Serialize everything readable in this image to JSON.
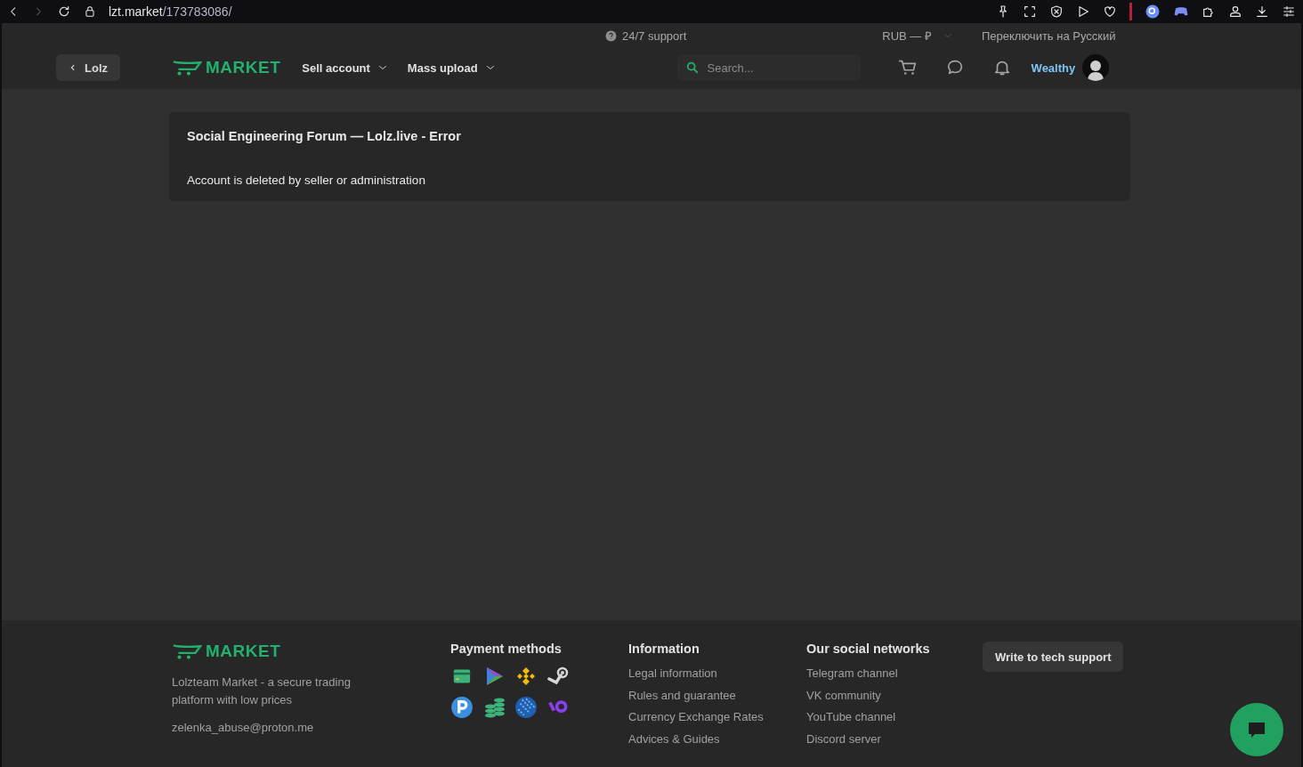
{
  "browser": {
    "url_host": "lzt.market",
    "url_path": "/173783086/"
  },
  "top_bar": {
    "support": "24/7 support",
    "currency": "RUB — ₽",
    "language_switch": "Переключить на Русский"
  },
  "header": {
    "back_button": "Lolz",
    "logo": "MARKET",
    "nav": [
      {
        "label": "Sell account"
      },
      {
        "label": "Mass upload"
      }
    ],
    "search": {
      "placeholder": "Search..."
    },
    "username": "Wealthy"
  },
  "error": {
    "title": "Social Engineering Forum — Lolz.live - Error",
    "message": "Account is deleted by seller or administration"
  },
  "footer": {
    "logo": "MARKET",
    "description": "Lolzteam Market - a secure trading platform with low prices",
    "email": "zelenka_abuse@proton.me",
    "payment_title": "Payment methods",
    "information": {
      "title": "Information",
      "links": [
        "Legal information",
        "Rules and guarantee",
        "Currency Exchange Rates",
        "Advices & Guides"
      ]
    },
    "social": {
      "title": "Our social networks",
      "links": [
        "Telegram channel",
        "VK community",
        "YouTube channel",
        "Discord server"
      ]
    },
    "support_button": "Write to tech support"
  }
}
